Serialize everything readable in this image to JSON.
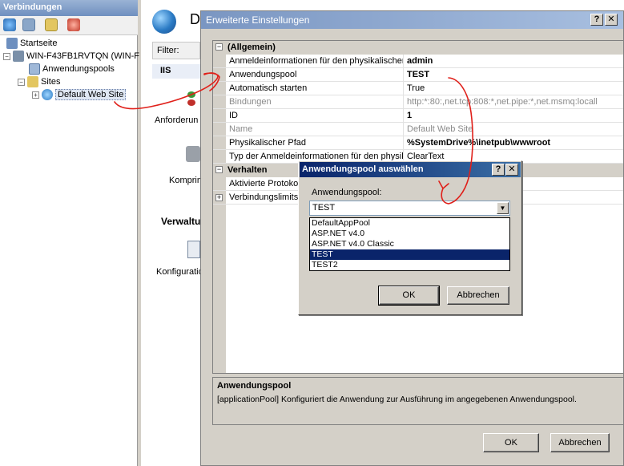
{
  "connections": {
    "header": "Verbindungen",
    "tree": {
      "start_page": "Startseite",
      "server": "WIN-F43FB1RVTQN (WIN-F",
      "app_pools": "Anwendungspools",
      "sites": "Sites",
      "default_site": "Default Web Site"
    }
  },
  "middle": {
    "title_initial": "D",
    "filter_label": "Filter:",
    "iis_label": "IIS",
    "requests": "Anforderun",
    "compression": "Komprim",
    "management": "Verwaltu",
    "configuration": "Konfiguratio"
  },
  "dialog": {
    "title": "Erweiterte Einstellungen",
    "help_button": "?",
    "close_button": "✕",
    "categories": {
      "general": "(Allgemein)",
      "behavior": "Verhalten"
    },
    "general_rows": [
      {
        "name": "Anmeldeinformationen für den physikalischen",
        "value": "admin",
        "bold": true,
        "grey": false
      },
      {
        "name": "Anwendungspool",
        "value": "TEST",
        "bold": true,
        "grey": false
      },
      {
        "name": "Automatisch starten",
        "value": "True",
        "bold": false,
        "grey": false
      },
      {
        "name": "Bindungen",
        "value": "http:*:80:,net.tcp:808:*,net.pipe:*,net.msmq:locall",
        "bold": false,
        "grey": true
      },
      {
        "name": "ID",
        "value": "1",
        "bold": true,
        "grey": false
      },
      {
        "name": "Name",
        "value": "Default Web Site",
        "bold": false,
        "grey": true
      },
      {
        "name": "Physikalischer Pfad",
        "value": "%SystemDrive%\\inetpub\\wwwroot",
        "bold": true,
        "grey": false
      },
      {
        "name": "Typ der Anmeldeinformationen für den physik",
        "value": "ClearText",
        "bold": false,
        "grey": false
      }
    ],
    "behavior_rows": [
      {
        "name": "Aktivierte Protokol",
        "expandable": false
      },
      {
        "name": "Verbindungslimits",
        "expandable": true
      }
    ],
    "description": {
      "title": "Anwendungspool",
      "text": "[applicationPool] Konfiguriert die Anwendung zur Ausführung im angegebenen Anwendungspool."
    },
    "ok_label": "OK",
    "cancel_label": "Abbrechen"
  },
  "pool_dialog": {
    "title": "Anwendungspool auswählen",
    "help_button": "?",
    "close_button": "✕",
    "field_label": "Anwendungspool:",
    "selected_value": "TEST",
    "options": [
      "DefaultAppPool",
      "ASP.NET v4.0",
      "ASP.NET v4.0 Classic",
      "TEST",
      "TEST2"
    ],
    "selected_index": 3,
    "ok_label": "OK",
    "cancel_label": "Abbrechen"
  },
  "colors": {
    "annotation_red": "#e0201a",
    "selection_blue": "#0a246a"
  }
}
